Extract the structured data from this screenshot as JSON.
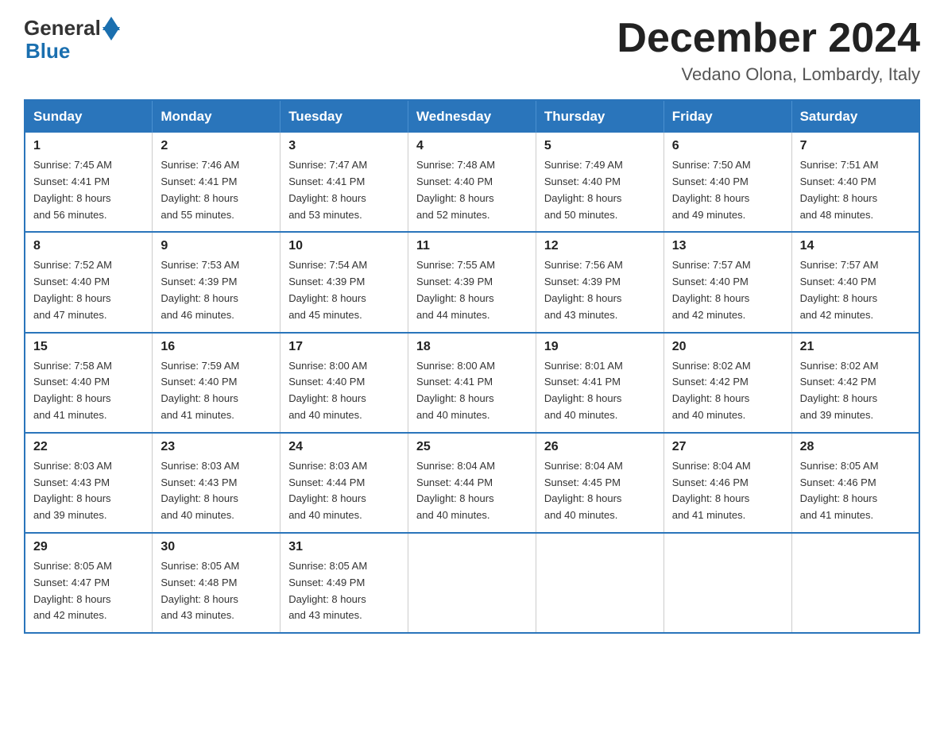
{
  "header": {
    "logo": {
      "general": "General",
      "blue": "Blue"
    },
    "title": "December 2024",
    "location": "Vedano Olona, Lombardy, Italy"
  },
  "days_of_week": [
    "Sunday",
    "Monday",
    "Tuesday",
    "Wednesday",
    "Thursday",
    "Friday",
    "Saturday"
  ],
  "weeks": [
    [
      {
        "day": "1",
        "sunrise": "7:45 AM",
        "sunset": "4:41 PM",
        "daylight": "8 hours and 56 minutes."
      },
      {
        "day": "2",
        "sunrise": "7:46 AM",
        "sunset": "4:41 PM",
        "daylight": "8 hours and 55 minutes."
      },
      {
        "day": "3",
        "sunrise": "7:47 AM",
        "sunset": "4:41 PM",
        "daylight": "8 hours and 53 minutes."
      },
      {
        "day": "4",
        "sunrise": "7:48 AM",
        "sunset": "4:40 PM",
        "daylight": "8 hours and 52 minutes."
      },
      {
        "day": "5",
        "sunrise": "7:49 AM",
        "sunset": "4:40 PM",
        "daylight": "8 hours and 50 minutes."
      },
      {
        "day": "6",
        "sunrise": "7:50 AM",
        "sunset": "4:40 PM",
        "daylight": "8 hours and 49 minutes."
      },
      {
        "day": "7",
        "sunrise": "7:51 AM",
        "sunset": "4:40 PM",
        "daylight": "8 hours and 48 minutes."
      }
    ],
    [
      {
        "day": "8",
        "sunrise": "7:52 AM",
        "sunset": "4:40 PM",
        "daylight": "8 hours and 47 minutes."
      },
      {
        "day": "9",
        "sunrise": "7:53 AM",
        "sunset": "4:39 PM",
        "daylight": "8 hours and 46 minutes."
      },
      {
        "day": "10",
        "sunrise": "7:54 AM",
        "sunset": "4:39 PM",
        "daylight": "8 hours and 45 minutes."
      },
      {
        "day": "11",
        "sunrise": "7:55 AM",
        "sunset": "4:39 PM",
        "daylight": "8 hours and 44 minutes."
      },
      {
        "day": "12",
        "sunrise": "7:56 AM",
        "sunset": "4:39 PM",
        "daylight": "8 hours and 43 minutes."
      },
      {
        "day": "13",
        "sunrise": "7:57 AM",
        "sunset": "4:40 PM",
        "daylight": "8 hours and 42 minutes."
      },
      {
        "day": "14",
        "sunrise": "7:57 AM",
        "sunset": "4:40 PM",
        "daylight": "8 hours and 42 minutes."
      }
    ],
    [
      {
        "day": "15",
        "sunrise": "7:58 AM",
        "sunset": "4:40 PM",
        "daylight": "8 hours and 41 minutes."
      },
      {
        "day": "16",
        "sunrise": "7:59 AM",
        "sunset": "4:40 PM",
        "daylight": "8 hours and 41 minutes."
      },
      {
        "day": "17",
        "sunrise": "8:00 AM",
        "sunset": "4:40 PM",
        "daylight": "8 hours and 40 minutes."
      },
      {
        "day": "18",
        "sunrise": "8:00 AM",
        "sunset": "4:41 PM",
        "daylight": "8 hours and 40 minutes."
      },
      {
        "day": "19",
        "sunrise": "8:01 AM",
        "sunset": "4:41 PM",
        "daylight": "8 hours and 40 minutes."
      },
      {
        "day": "20",
        "sunrise": "8:02 AM",
        "sunset": "4:42 PM",
        "daylight": "8 hours and 40 minutes."
      },
      {
        "day": "21",
        "sunrise": "8:02 AM",
        "sunset": "4:42 PM",
        "daylight": "8 hours and 39 minutes."
      }
    ],
    [
      {
        "day": "22",
        "sunrise": "8:03 AM",
        "sunset": "4:43 PM",
        "daylight": "8 hours and 39 minutes."
      },
      {
        "day": "23",
        "sunrise": "8:03 AM",
        "sunset": "4:43 PM",
        "daylight": "8 hours and 40 minutes."
      },
      {
        "day": "24",
        "sunrise": "8:03 AM",
        "sunset": "4:44 PM",
        "daylight": "8 hours and 40 minutes."
      },
      {
        "day": "25",
        "sunrise": "8:04 AM",
        "sunset": "4:44 PM",
        "daylight": "8 hours and 40 minutes."
      },
      {
        "day": "26",
        "sunrise": "8:04 AM",
        "sunset": "4:45 PM",
        "daylight": "8 hours and 40 minutes."
      },
      {
        "day": "27",
        "sunrise": "8:04 AM",
        "sunset": "4:46 PM",
        "daylight": "8 hours and 41 minutes."
      },
      {
        "day": "28",
        "sunrise": "8:05 AM",
        "sunset": "4:46 PM",
        "daylight": "8 hours and 41 minutes."
      }
    ],
    [
      {
        "day": "29",
        "sunrise": "8:05 AM",
        "sunset": "4:47 PM",
        "daylight": "8 hours and 42 minutes."
      },
      {
        "day": "30",
        "sunrise": "8:05 AM",
        "sunset": "4:48 PM",
        "daylight": "8 hours and 43 minutes."
      },
      {
        "day": "31",
        "sunrise": "8:05 AM",
        "sunset": "4:49 PM",
        "daylight": "8 hours and 43 minutes."
      },
      null,
      null,
      null,
      null
    ]
  ],
  "labels": {
    "sunrise": "Sunrise:",
    "sunset": "Sunset:",
    "daylight": "Daylight:"
  }
}
